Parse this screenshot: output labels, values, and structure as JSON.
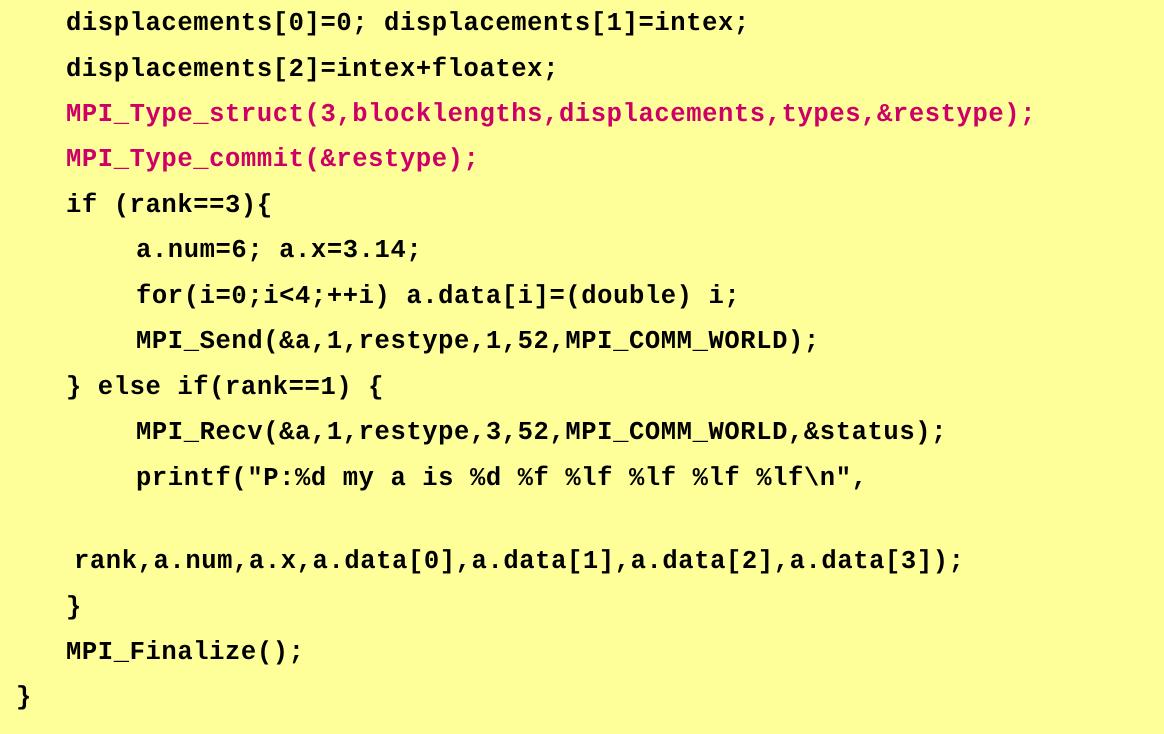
{
  "colors": {
    "background": "#ffff99",
    "text": "#000000",
    "highlight": "#cc0066"
  },
  "code_lines": [
    {
      "text": "displacements[0]=0; displacements[1]=intex;",
      "highlight": false
    },
    {
      "text": "displacements[2]=intex+floatex;",
      "highlight": false
    },
    {
      "text": "MPI_Type_struct(3,blocklengths,displacements,types,&restype);",
      "highlight": true
    },
    {
      "text": "MPI_Type_commit(&restype);",
      "highlight": true
    },
    {
      "text": "if (rank==3){",
      "highlight": false
    },
    {
      "text": "a.num=6; a.x=3.14;",
      "highlight": false
    },
    {
      "text": "for(i=0;i<4;++i) a.data[i]=(double) i;",
      "highlight": false
    },
    {
      "text": "MPI_Send(&a,1,restype,1,52,MPI_COMM_WORLD);",
      "highlight": false
    },
    {
      "text": "} else if(rank==1) {",
      "highlight": false
    },
    {
      "text": "MPI_Recv(&a,1,restype,3,52,MPI_COMM_WORLD,&status);",
      "highlight": false
    },
    {
      "text": "printf(\"P:%d my a is %d %f %lf %lf %lf %lf\\n\",",
      "highlight": false
    },
    {
      "text": "rank,a.num,a.x,a.data[0],a.data[1],a.data[2],a.data[3]);",
      "highlight": false
    },
    {
      "text": "}",
      "highlight": false
    },
    {
      "text": "MPI_Finalize();",
      "highlight": false
    },
    {
      "text": "}",
      "highlight": false
    }
  ]
}
